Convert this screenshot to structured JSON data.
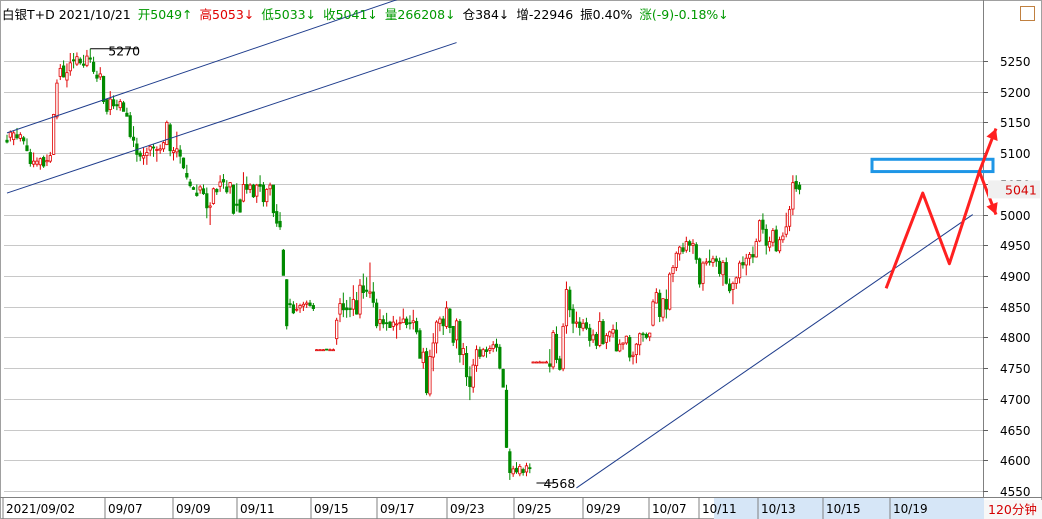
{
  "header": {
    "title": "白银T+D 2021/10/21",
    "open": "开5049↑",
    "high": "高5053↓",
    "low": "低5033↓",
    "close": "收5041↓",
    "volume": "量266208↓",
    "open_interest": "仓384↓",
    "delta": "增-22946",
    "amplitude": "振0.40%",
    "change": "涨(-9)-0.18%↓"
  },
  "period": "120分钟",
  "colors": {
    "up": "#e00000",
    "down": "#008a00",
    "trendline": "#1e3c8c",
    "annotation": "#ff2020",
    "box": "#1e96e6",
    "grid": "#c8c8c8"
  },
  "chart_data": {
    "type": "candlestick",
    "instrument": "白银T+D",
    "ylim": [
      4540,
      5300
    ],
    "y_ticks": [
      4550,
      4600,
      4650,
      4700,
      4750,
      4800,
      4850,
      4900,
      4950,
      5000,
      5050,
      5100,
      5150,
      5200,
      5250
    ],
    "x_tick_labels": [
      "2021/09/02",
      "09/07",
      "09/09",
      "09/11",
      "09/15",
      "09/17",
      "09/23",
      "09/25",
      "09/29",
      "10/07",
      "10/11",
      "10/13",
      "10/15",
      "10/19"
    ],
    "last_price": 5041,
    "annotations": [
      {
        "type": "label",
        "text": "5270",
        "value": 5270
      },
      {
        "type": "label",
        "text": "4568",
        "value": 4568
      },
      {
        "type": "trendline",
        "name": "upper-channel",
        "from": [
          0,
          5035
        ],
        "to": [
          135,
          5280
        ]
      },
      {
        "type": "trendline",
        "name": "lower-channel",
        "from": [
          0,
          5133
        ],
        "to": [
          135,
          5383
        ]
      },
      {
        "type": "trendline",
        "name": "rising-support",
        "from": [
          171,
          4555
        ],
        "to": [
          290,
          5000
        ]
      },
      {
        "type": "price-box",
        "range": [
          5070,
          5090
        ]
      },
      {
        "type": "arrow-path",
        "points": [
          [
            264,
            4880
          ],
          [
            275,
            5035
          ],
          [
            283,
            4920
          ],
          [
            292,
            5070
          ],
          [
            297,
            5000
          ]
        ]
      },
      {
        "type": "arrow",
        "from": [
          292,
          5070
        ],
        "to": [
          297,
          5140
        ]
      }
    ],
    "candles": [
      [
        5121,
        5130,
        5116,
        5118
      ],
      [
        5126,
        5137,
        5119,
        5134
      ],
      [
        5122,
        5136,
        5113,
        5133
      ],
      [
        5130,
        5141,
        5122,
        5125
      ],
      [
        5124,
        5134,
        5119,
        5130
      ],
      [
        5125,
        5128,
        5114,
        5120
      ],
      [
        5112,
        5124,
        5103,
        5104
      ],
      [
        5101,
        5107,
        5078,
        5083
      ],
      [
        5082,
        5101,
        5077,
        5087
      ],
      [
        5082,
        5093,
        5078,
        5087
      ],
      [
        5081,
        5093,
        5073,
        5091
      ],
      [
        5093,
        5096,
        5076,
        5079
      ],
      [
        5086,
        5098,
        5079,
        5088
      ],
      [
        5087,
        5102,
        5084,
        5096
      ],
      [
        5098,
        5164,
        5097,
        5163
      ],
      [
        5159,
        5220,
        5155,
        5214
      ],
      [
        5225,
        5245,
        5219,
        5238
      ],
      [
        5242,
        5251,
        5223,
        5224
      ],
      [
        5219,
        5246,
        5207,
        5231
      ],
      [
        5234,
        5263,
        5226,
        5247
      ],
      [
        5252,
        5263,
        5238,
        5251
      ],
      [
        5245,
        5264,
        5242,
        5257
      ],
      [
        5253,
        5256,
        5244,
        5247
      ],
      [
        5245,
        5260,
        5239,
        5243
      ],
      [
        5243,
        5268,
        5240,
        5258
      ],
      [
        5255,
        5270,
        5247,
        5253
      ],
      [
        5248,
        5257,
        5229,
        5233
      ],
      [
        5227,
        5234,
        5216,
        5222
      ],
      [
        5224,
        5240,
        5219,
        5229
      ],
      [
        5225,
        5226,
        5180,
        5184
      ],
      [
        5187,
        5189,
        5163,
        5168
      ],
      [
        5171,
        5201,
        5162,
        5188
      ],
      [
        5187,
        5194,
        5172,
        5177
      ],
      [
        5179,
        5187,
        5170,
        5177
      ],
      [
        5174,
        5188,
        5169,
        5184
      ],
      [
        5182,
        5185,
        5168,
        5168
      ],
      [
        5165,
        5174,
        5160,
        5160
      ],
      [
        5161,
        5167,
        5124,
        5127
      ],
      [
        5126,
        5144,
        5110,
        5121
      ],
      [
        5115,
        5125,
        5086,
        5098
      ],
      [
        5100,
        5104,
        5087,
        5095
      ],
      [
        5092,
        5109,
        5081,
        5096
      ],
      [
        5096,
        5109,
        5081,
        5101
      ],
      [
        5105,
        5114,
        5095,
        5111
      ],
      [
        5110,
        5115,
        5094,
        5109
      ],
      [
        5105,
        5111,
        5086,
        5106
      ],
      [
        5105,
        5114,
        5099,
        5107
      ],
      [
        5107,
        5119,
        5102,
        5117
      ],
      [
        5114,
        5153,
        5113,
        5150
      ],
      [
        5146,
        5149,
        5095,
        5104
      ],
      [
        5101,
        5110,
        5088,
        5104
      ],
      [
        5102,
        5135,
        5093,
        5107
      ],
      [
        5105,
        5113,
        5083,
        5095
      ],
      [
        5092,
        5093,
        5074,
        5076
      ],
      [
        5067,
        5081,
        5057,
        5061
      ],
      [
        5053,
        5058,
        5044,
        5047
      ],
      [
        5044,
        5046,
        5040,
        5041
      ],
      [
        5035,
        5049,
        5029,
        5031
      ],
      [
        5040,
        5048,
        5034,
        5045
      ],
      [
        5042,
        5049,
        5032,
        5034
      ],
      [
        5034,
        5044,
        4994,
        5011
      ],
      [
        5012,
        5020,
        4983,
        5014
      ],
      [
        5018,
        5044,
        5016,
        5042
      ],
      [
        5041,
        5043,
        5032,
        5037
      ],
      [
        5046,
        5064,
        5037,
        5053
      ],
      [
        5057,
        5066,
        5042,
        5053
      ],
      [
        5045,
        5056,
        5034,
        5037
      ],
      [
        5045,
        5053,
        5034,
        5052
      ],
      [
        5048,
        5049,
        5000,
        5002
      ],
      [
        5017,
        5051,
        5005,
        5015
      ],
      [
        5024,
        5026,
        5003,
        5004
      ],
      [
        5022,
        5069,
        5020,
        5049
      ],
      [
        5049,
        5062,
        5034,
        5041
      ],
      [
        5041,
        5051,
        5035,
        5048
      ],
      [
        5048,
        5050,
        5027,
        5029
      ],
      [
        5030,
        5050,
        5019,
        5048
      ],
      [
        5049,
        5064,
        5037,
        5046
      ],
      [
        5048,
        5053,
        5013,
        5021
      ],
      [
        5021,
        5043,
        5013,
        5041
      ],
      [
        5042,
        5052,
        5031,
        5048
      ],
      [
        5048,
        5048,
        4996,
        5003
      ],
      [
        5005,
        5017,
        4980,
        4986
      ],
      [
        4989,
        5004,
        4975,
        4980
      ],
      [
        4942,
        4944,
        4901,
        4901
      ],
      [
        4894,
        4895,
        4813,
        4819
      ],
      [
        4855,
        4863,
        4848,
        4854
      ],
      [
        4853,
        4859,
        4838,
        4840
      ],
      [
        4846,
        4856,
        4842,
        4846
      ],
      [
        4848,
        4855,
        4840,
        4852
      ],
      [
        4851,
        4858,
        4843,
        4854
      ],
      [
        4854,
        4860,
        4848,
        4856
      ],
      [
        4856,
        4861,
        4850,
        4852
      ],
      [
        4852,
        4856,
        4843,
        4847
      ],
      [
        4780,
        4781,
        4780,
        4780
      ],
      [
        4780,
        4781,
        4779,
        4780
      ],
      [
        4780,
        4781,
        4779,
        4780
      ],
      [
        4781,
        4781,
        4780,
        4780
      ],
      [
        4780,
        4782,
        4779,
        4780
      ],
      [
        4780,
        4782,
        4778,
        4780
      ],
      [
        4798,
        4832,
        4788,
        4828
      ],
      [
        4838,
        4864,
        4825,
        4855
      ],
      [
        4855,
        4873,
        4833,
        4845
      ],
      [
        4848,
        4861,
        4832,
        4845
      ],
      [
        4847,
        4866,
        4833,
        4846
      ],
      [
        4846,
        4885,
        4835,
        4862
      ],
      [
        4860,
        4874,
        4837,
        4838
      ],
      [
        4838,
        4895,
        4831,
        4885
      ],
      [
        4884,
        4904,
        4863,
        4873
      ],
      [
        4877,
        4898,
        4866,
        4875
      ],
      [
        4872,
        4922,
        4864,
        4874
      ],
      [
        4874,
        4890,
        4849,
        4857
      ],
      [
        4856,
        4863,
        4815,
        4819
      ],
      [
        4823,
        4846,
        4811,
        4829
      ],
      [
        4829,
        4836,
        4815,
        4822
      ],
      [
        4824,
        4840,
        4811,
        4823
      ],
      [
        4825,
        4827,
        4816,
        4816
      ],
      [
        4818,
        4835,
        4811,
        4825
      ],
      [
        4822,
        4829,
        4798,
        4822
      ],
      [
        4823,
        4834,
        4812,
        4824
      ],
      [
        4824,
        4847,
        4824,
        4830
      ],
      [
        4830,
        4834,
        4815,
        4821
      ],
      [
        4824,
        4836,
        4813,
        4823
      ],
      [
        4824,
        4845,
        4813,
        4827
      ],
      [
        4826,
        4832,
        4805,
        4809
      ],
      [
        4811,
        4815,
        4766,
        4766
      ],
      [
        4759,
        4783,
        4749,
        4776
      ],
      [
        4777,
        4783,
        4706,
        4710
      ],
      [
        4708,
        4780,
        4704,
        4769
      ],
      [
        4768,
        4807,
        4745,
        4791
      ],
      [
        4791,
        4828,
        4774,
        4825
      ],
      [
        4823,
        4834,
        4810,
        4830
      ],
      [
        4830,
        4835,
        4804,
        4819
      ],
      [
        4818,
        4859,
        4814,
        4848
      ],
      [
        4846,
        4848,
        4807,
        4816
      ],
      [
        4818,
        4818,
        4786,
        4792
      ],
      [
        4796,
        4831,
        4782,
        4827
      ],
      [
        4826,
        4830,
        4759,
        4772
      ],
      [
        4772,
        4791,
        4755,
        4782
      ],
      [
        4774,
        4786,
        4721,
        4736
      ],
      [
        4736,
        4753,
        4698,
        4720
      ],
      [
        4719,
        4765,
        4710,
        4755
      ],
      [
        4754,
        4787,
        4744,
        4780
      ],
      [
        4780,
        4785,
        4765,
        4769
      ],
      [
        4770,
        4783,
        4768,
        4780
      ],
      [
        4780,
        4785,
        4767,
        4777
      ],
      [
        4779,
        4787,
        4773,
        4782
      ],
      [
        4782,
        4794,
        4776,
        4788
      ],
      [
        4789,
        4798,
        4777,
        4784
      ],
      [
        4784,
        4789,
        4748,
        4750
      ],
      [
        4748,
        4749,
        4719,
        4719
      ],
      [
        4714,
        4723,
        4620,
        4621
      ],
      [
        4614,
        4619,
        4568,
        4580
      ],
      [
        4578,
        4591,
        4573,
        4586
      ],
      [
        4587,
        4597,
        4578,
        4581
      ],
      [
        4578,
        4594,
        4574,
        4590
      ],
      [
        4585,
        4588,
        4575,
        4580
      ],
      [
        4581,
        4596,
        4574,
        4591
      ],
      [
        4588,
        4595,
        4579,
        4587
      ],
      [
        4760,
        4761,
        4759,
        4760
      ],
      [
        4760,
        4761,
        4759,
        4760
      ],
      [
        4760,
        4762,
        4759,
        4760
      ],
      [
        4760,
        4760,
        4759,
        4760
      ],
      [
        4760,
        4762,
        4759,
        4760
      ],
      [
        4757,
        4781,
        4743,
        4753
      ],
      [
        4752,
        4812,
        4748,
        4808
      ],
      [
        4805,
        4818,
        4758,
        4764
      ],
      [
        4765,
        4770,
        4746,
        4748
      ],
      [
        4749,
        4823,
        4745,
        4818
      ],
      [
        4819,
        4891,
        4806,
        4878
      ],
      [
        4877,
        4883,
        4833,
        4845
      ],
      [
        4846,
        4854,
        4807,
        4823
      ],
      [
        4823,
        4842,
        4816,
        4825
      ],
      [
        4825,
        4833,
        4803,
        4816
      ],
      [
        4815,
        4830,
        4810,
        4823
      ],
      [
        4824,
        4832,
        4812,
        4815
      ],
      [
        4815,
        4822,
        4785,
        4795
      ],
      [
        4796,
        4813,
        4791,
        4804
      ],
      [
        4805,
        4809,
        4781,
        4787
      ],
      [
        4787,
        4841,
        4784,
        4826
      ],
      [
        4826,
        4830,
        4788,
        4790
      ],
      [
        4792,
        4807,
        4781,
        4803
      ],
      [
        4802,
        4811,
        4793,
        4809
      ],
      [
        4807,
        4821,
        4800,
        4813
      ],
      [
        4812,
        4825,
        4777,
        4778
      ],
      [
        4778,
        4797,
        4776,
        4789
      ],
      [
        4789,
        4792,
        4780,
        4791
      ],
      [
        4791,
        4803,
        4788,
        4802
      ],
      [
        4800,
        4804,
        4761,
        4768
      ],
      [
        4769,
        4777,
        4756,
        4771
      ],
      [
        4772,
        4791,
        4758,
        4789
      ],
      [
        4788,
        4808,
        4771,
        4806
      ],
      [
        4806,
        4809,
        4793,
        4805
      ],
      [
        4805,
        4808,
        4797,
        4800
      ],
      [
        4801,
        4808,
        4794,
        4807
      ],
      [
        4820,
        4862,
        4818,
        4858
      ],
      [
        4856,
        4880,
        4855,
        4873
      ],
      [
        4872,
        4878,
        4825,
        4834
      ],
      [
        4833,
        4864,
        4826,
        4863
      ],
      [
        4862,
        4878,
        4831,
        4846
      ],
      [
        4846,
        4906,
        4844,
        4903
      ],
      [
        4904,
        4918,
        4890,
        4914
      ],
      [
        4914,
        4940,
        4908,
        4937
      ],
      [
        4936,
        4949,
        4925,
        4947
      ],
      [
        4946,
        4954,
        4936,
        4940
      ],
      [
        4942,
        4964,
        4938,
        4956
      ],
      [
        4956,
        4959,
        4939,
        4950
      ],
      [
        4950,
        4960,
        4936,
        4953
      ],
      [
        4951,
        4955,
        4920,
        4927
      ],
      [
        4928,
        4930,
        4881,
        4887
      ],
      [
        4888,
        4924,
        4876,
        4921
      ],
      [
        4921,
        4929,
        4917,
        4923
      ],
      [
        4924,
        4943,
        4917,
        4923
      ],
      [
        4922,
        4933,
        4915,
        4928
      ],
      [
        4928,
        4933,
        4915,
        4924
      ],
      [
        4924,
        4930,
        4899,
        4904
      ],
      [
        4902,
        4926,
        4884,
        4922
      ],
      [
        4922,
        4930,
        4886,
        4888
      ],
      [
        4887,
        4896,
        4872,
        4876
      ],
      [
        4878,
        4891,
        4854,
        4888
      ],
      [
        4888,
        4899,
        4879,
        4897
      ],
      [
        4897,
        4925,
        4888,
        4921
      ],
      [
        4922,
        4932,
        4912,
        4918
      ],
      [
        4918,
        4936,
        4901,
        4929
      ],
      [
        4929,
        4939,
        4917,
        4935
      ],
      [
        4935,
        4948,
        4921,
        4931
      ],
      [
        4931,
        4961,
        4930,
        4956
      ],
      [
        4957,
        4992,
        4955,
        4990
      ],
      [
        4991,
        5002,
        4969,
        4976
      ],
      [
        4976,
        4984,
        4935,
        4950
      ],
      [
        4947,
        4964,
        4940,
        4956
      ],
      [
        4955,
        4978,
        4948,
        4974
      ],
      [
        4975,
        4982,
        4939,
        4941
      ],
      [
        4941,
        4964,
        4937,
        4959
      ],
      [
        4959,
        4971,
        4954,
        4965
      ],
      [
        4968,
        5003,
        4963,
        4980
      ],
      [
        4981,
        5014,
        4973,
        5008
      ],
      [
        5009,
        5064,
        4999,
        5052
      ],
      [
        5054,
        5064,
        5037,
        5042
      ],
      [
        5048,
        5053,
        5033,
        5041
      ]
    ]
  }
}
